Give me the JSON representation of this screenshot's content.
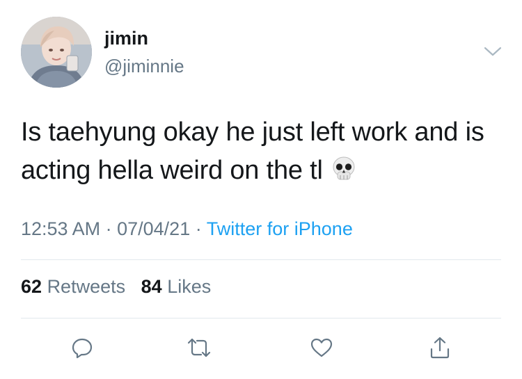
{
  "tweet": {
    "author": {
      "display_name": "jimin",
      "handle": "@jiminnie",
      "avatar_icon": "profile-photo"
    },
    "text": "Is taehyung okay he just left work and is acting hella weird on the tl",
    "emoji_icon": "skull-emoji",
    "time": "12:53 AM",
    "separator": "·",
    "date": "07/04/21",
    "source": "Twitter for iPhone"
  },
  "stats": {
    "retweets_count": "62",
    "retweets_label": "Retweets",
    "likes_count": "84",
    "likes_label": "Likes"
  },
  "actions": {
    "reply_icon": "reply-icon",
    "retweet_icon": "retweet-icon",
    "like_icon": "heart-icon",
    "share_icon": "share-icon"
  },
  "colors": {
    "secondary_text": "#657786",
    "link": "#1da1f2",
    "divider": "#e1e8ed",
    "icon": "#657786"
  }
}
